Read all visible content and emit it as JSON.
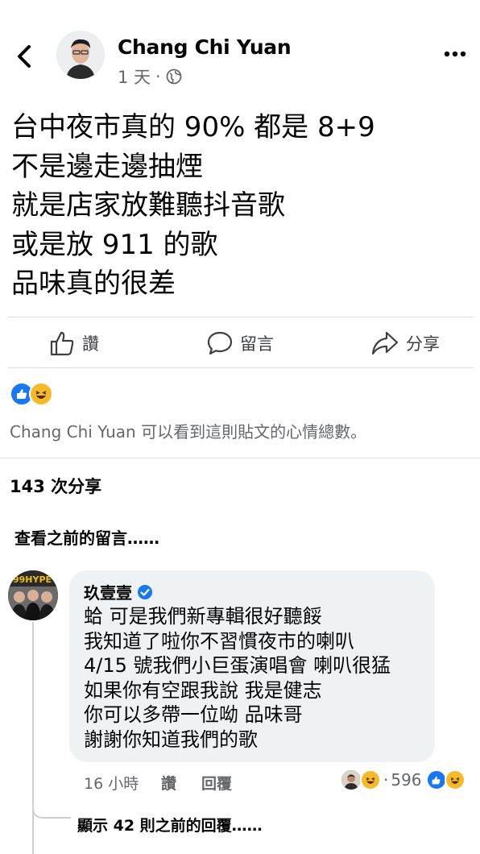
{
  "post": {
    "author": "Chang Chi Yuan",
    "time": "1 天",
    "separator": "·",
    "privacy_icon": "globe-icon",
    "lines": [
      "台中夜市真的 90% 都是 8+9",
      "不是邊走邊抽煙",
      "就是店家放難聽抖音歌",
      "或是放 911 的歌",
      "品味真的很差"
    ]
  },
  "actions": {
    "like": "讚",
    "comment": "留言",
    "share": "分享"
  },
  "reactions": {
    "icons": [
      "like-reaction-icon",
      "haha-reaction-icon"
    ],
    "note": "Chang Chi Yuan 可以看到這則貼文的心情總數。"
  },
  "shares": "143 次分享",
  "previous_comments": "查看之前的留言……",
  "comment": {
    "name": "玖壹壹",
    "verified": true,
    "lines": [
      "蛤 可是我們新專輯很好聽餒",
      "我知道了啦你不習慣夜市的喇叭",
      "4/15 號我們小巨蛋演唱會 喇叭很猛",
      "如果你有空跟我說 我是健志",
      "你可以多帶一位呦 品味哥",
      "謝謝你知道我們的歌"
    ],
    "time": "16 小時",
    "like": "讚",
    "reply": "回覆",
    "reaction_separator": "·",
    "reaction_count": "596"
  },
  "show_replies": "顯示 42 則之前的回覆……",
  "colors": {
    "like_blue": "#1877f2",
    "haha_yellow": "#f7b928",
    "secondary_text": "#65676b",
    "bubble_bg": "#eff2f5"
  }
}
